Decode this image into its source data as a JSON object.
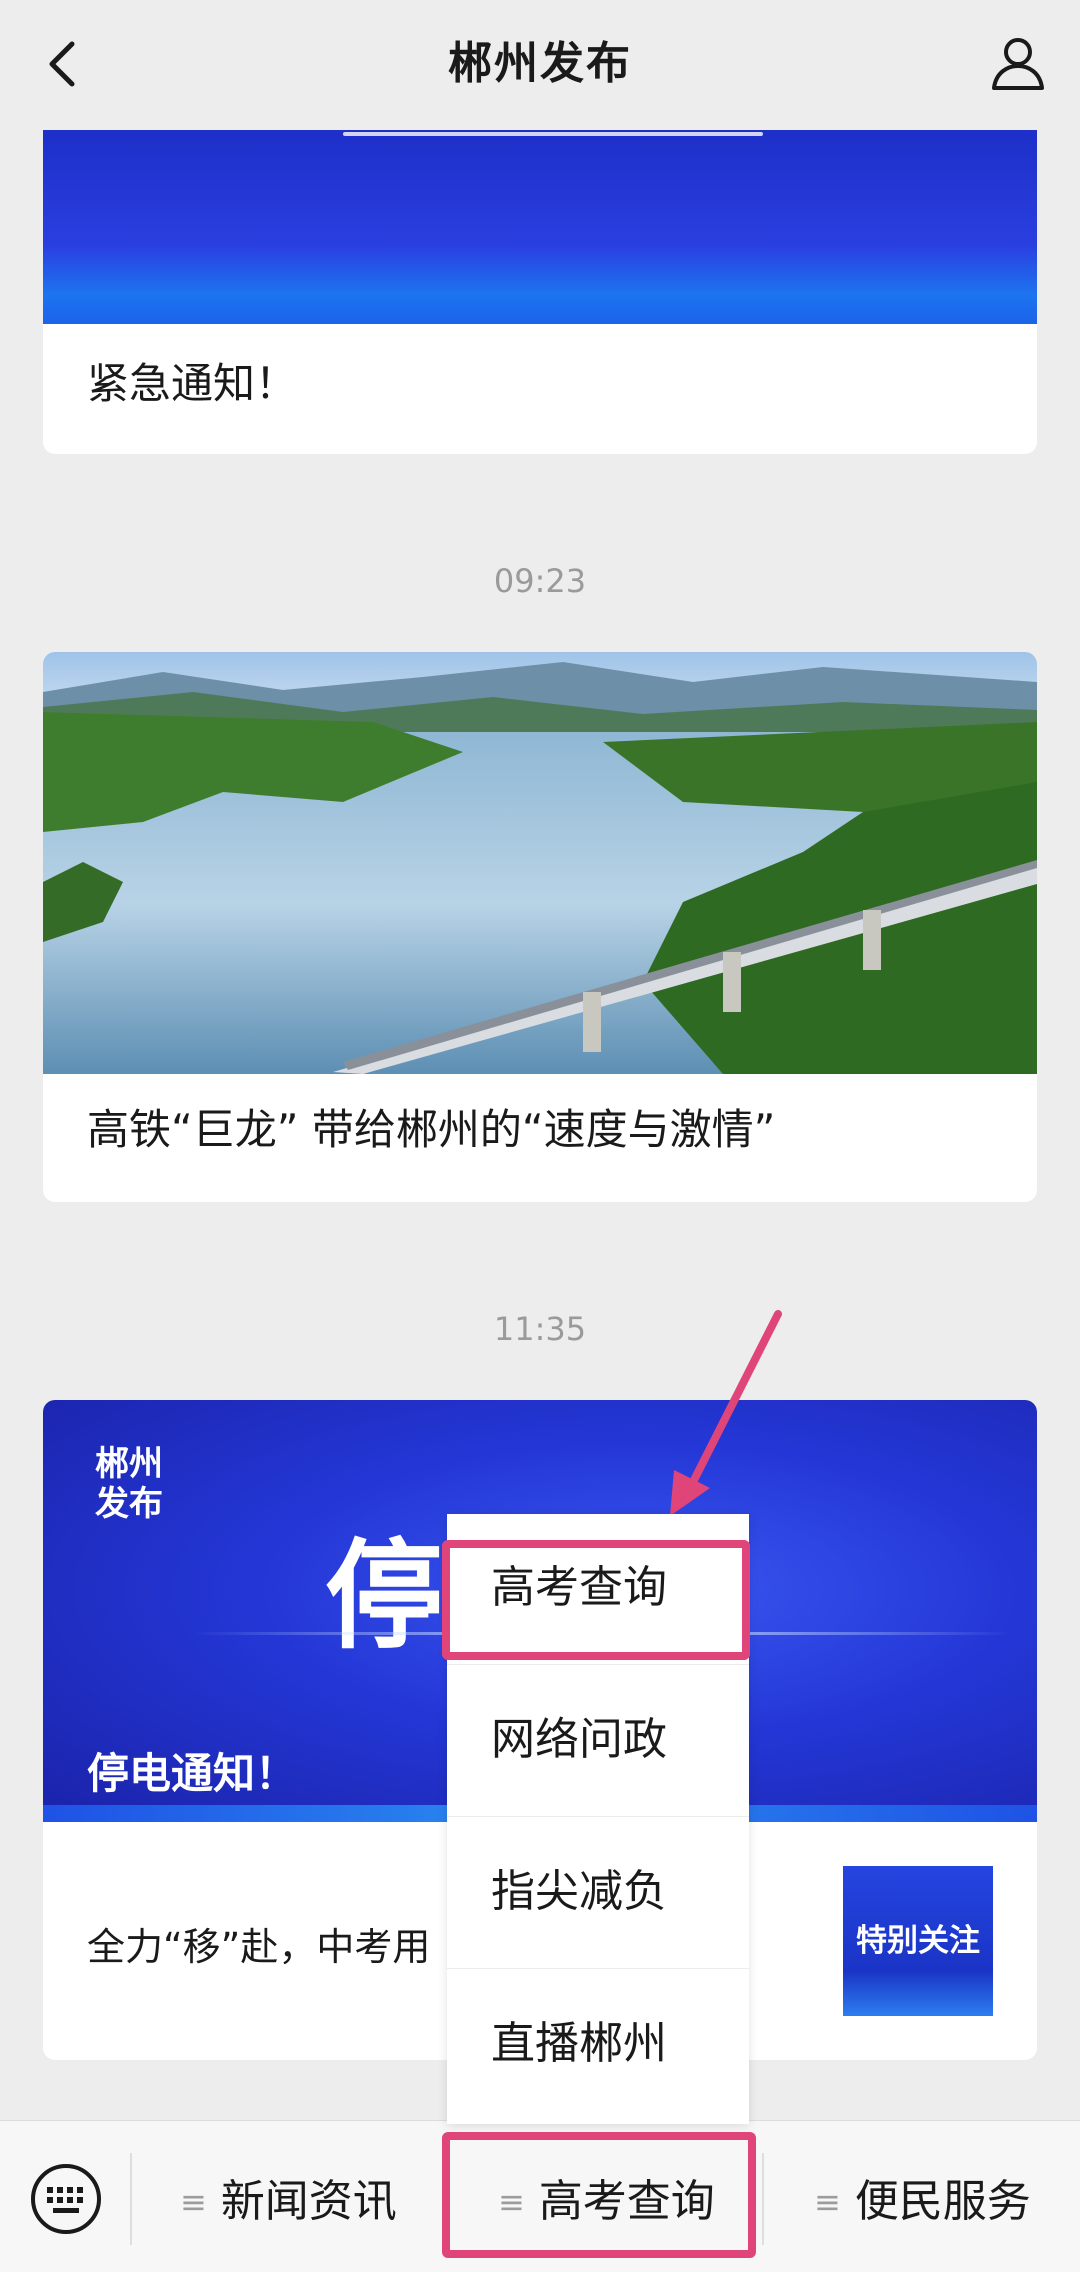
{
  "header": {
    "title": "郴州发布"
  },
  "articles": [
    {
      "title": "紧急通知！"
    },
    {
      "timestamp": "09:23",
      "title": "高铁“巨龙” 带给郴州的“速度与激情”"
    },
    {
      "timestamp": "11:35",
      "banner_logo_line1": "郴州",
      "banner_logo_line2": "发布",
      "banner_char": "停",
      "banner_caption": "停电通知！",
      "sub_title": "全力“移”赴，中考用",
      "thumb_text": "特别关注"
    }
  ],
  "popup_menu": {
    "items": [
      "高考查询",
      "网络问政",
      "指尖减负",
      "直播郴州"
    ]
  },
  "bottom_menu": {
    "tabs": [
      "新闻资讯",
      "高考查询",
      "便民服务"
    ]
  },
  "colors": {
    "highlight": "#e0457a",
    "banner_blue": "#2437d6"
  }
}
